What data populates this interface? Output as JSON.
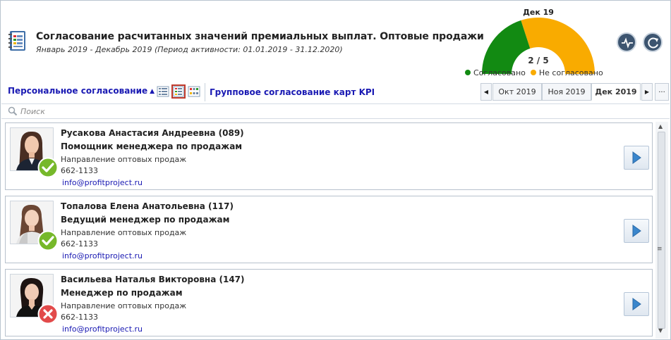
{
  "header": {
    "title": "Согласование расчитанных значений премиальных выплат. Оптовые продажи",
    "subtitle": "Январь 2019  - Декабрь 2019 (Период активности: 01.01.2019 - 31.12.2020)"
  },
  "gauge": {
    "month": "Дек 19",
    "value_text": "2 / 5",
    "approved": 2,
    "total": 5,
    "legend_approved": "Согласовано",
    "legend_not_approved": "Не согласовано",
    "color_approved": "#128a12",
    "color_not_approved": "#f9ab00"
  },
  "actions": {
    "pulse_icon": "pulse-icon",
    "refresh_icon": "refresh-icon"
  },
  "toolbar": {
    "personal_label": "Персональное согласование",
    "group_label": "Групповое согласование карт KPI",
    "months": [
      "Окт 2019",
      "Ноя 2019",
      "Дек 2019"
    ],
    "selected_month": "Дек 2019",
    "more_label": "..."
  },
  "search": {
    "placeholder": "Поиск"
  },
  "employees": [
    {
      "name": "Русакова Анастасия Андреевна  (089)",
      "position": "Помощник менеджера по продажам",
      "department": "Направление оптовых продаж",
      "phone": "662-1133",
      "email": "info@profitproject.ru",
      "status": "approved"
    },
    {
      "name": "Топалова Елена Анатольевна  (117)",
      "position": "Ведущий менеджер по продажам",
      "department": "Направление оптовых продаж",
      "phone": "662-1133",
      "email": "info@profitproject.ru",
      "status": "approved"
    },
    {
      "name": "Васильева Наталья Викторовна  (147)",
      "position": "Менеджер по продажам",
      "department": "Направление оптовых продаж",
      "phone": "662-1133",
      "email": "info@profitproject.ru",
      "status": "rejected"
    }
  ]
}
